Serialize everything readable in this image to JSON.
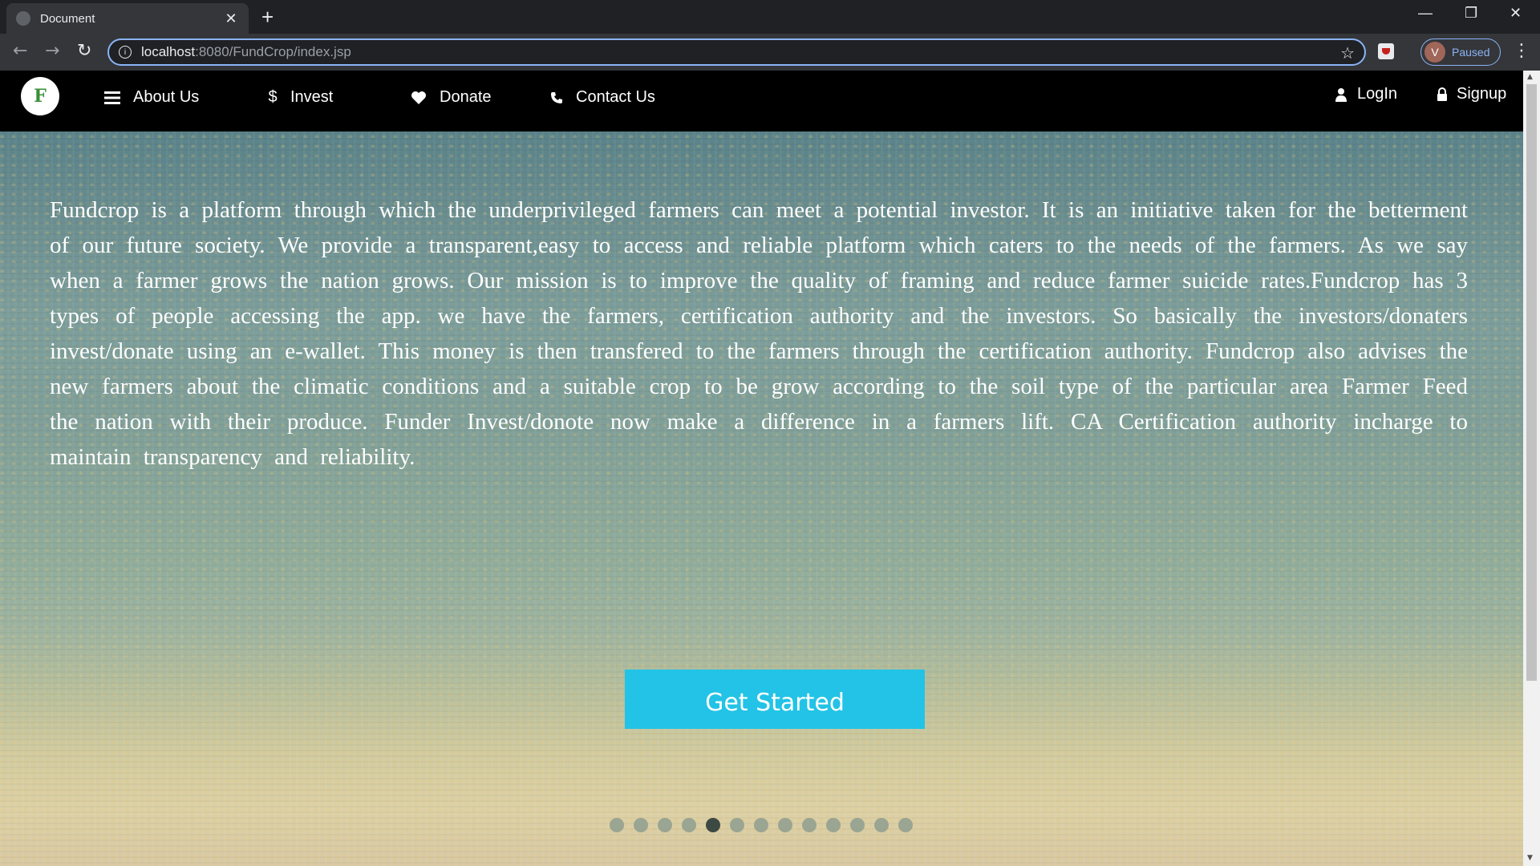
{
  "browser": {
    "tab_title": "Document",
    "tab_close": "✕",
    "new_tab": "+",
    "url_host": "localhost",
    "url_path": ":8080/FundCrop/index.jsp",
    "profile_initial": "V",
    "profile_status": "Paused"
  },
  "site": {
    "logo_letter": "F",
    "nav": {
      "about": "About Us",
      "invest": "Invest",
      "donate": "Donate",
      "contact": "Contact Us",
      "login": "LogIn",
      "signup": "Signup"
    },
    "about_text": "Fundcrop is a platform through which the underprivileged farmers can meet a potential investor. It is an initiative taken for the betterment of our future society. We provide a transparent,easy to access and reliable platform which caters to the needs of the farmers. As we say when a farmer grows the nation grows. Our mission is to improve the quality of framing and reduce farmer suicide rates.Fundcrop has 3 types of people accessing the app. we have the farmers, certification authority and the investors. So basically the investors/donaters invest/donate using an e-wallet. This money is then transfered to the farmers through the certification authority. Fundcrop also advises the new farmers about the climatic conditions and a suitable crop to be grow according to the soil type of the particular area Farmer Feed the nation with their produce. Funder Invest/donote now make a difference in a farmers lift. CA Certification authority incharge to maintain transparency and reliability.",
    "cta_label": "Get Started",
    "carousel": {
      "total_slides": 13,
      "active_index": 4
    }
  },
  "colors": {
    "cta": "#22c3e6",
    "nav_bg": "#000000",
    "chrome_bg": "#35363a",
    "omnibox_focus": "#8ab4f8"
  }
}
